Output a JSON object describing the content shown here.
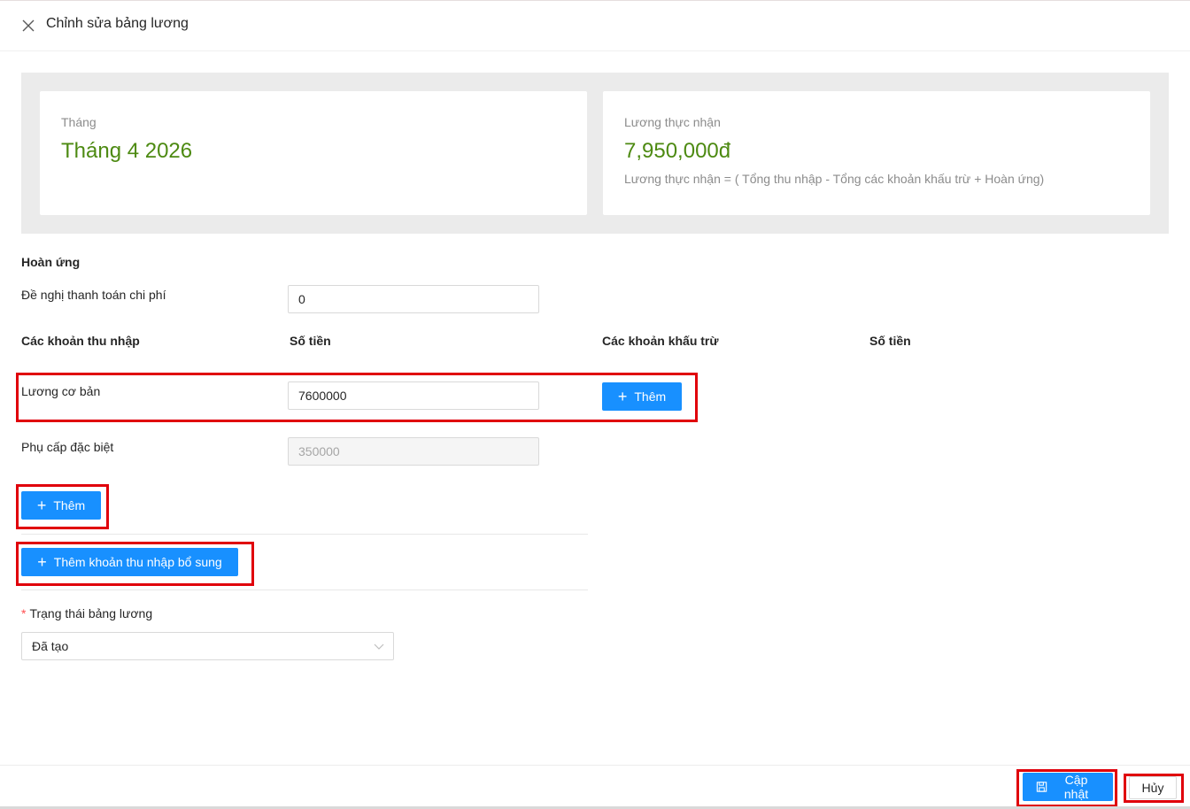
{
  "header": {
    "title": "Chỉnh sửa bảng lương"
  },
  "summary": {
    "month_label": "Tháng",
    "month_value": "Tháng 4 2026",
    "net_label": "Lương thực nhận",
    "net_value": "7,950,000đ",
    "net_formula": "Lương thực nhận = ( Tổng thu nhập - Tổng các khoản khấu trừ + Hoàn ứng)"
  },
  "reimbursement": {
    "title": "Hoàn ứng",
    "expense_label": "Đề nghị thanh toán chi phí",
    "expense_value": "0"
  },
  "columns": {
    "income": "Các khoản thu nhập",
    "income_amount": "Số tiền",
    "deduction": "Các khoản khấu trừ",
    "deduction_amount": "Số tiền"
  },
  "income_items": [
    {
      "label": "Lương cơ bản",
      "value": "7600000"
    },
    {
      "label": "Phụ cấp đặc biệt",
      "value": "350000"
    }
  ],
  "buttons": {
    "add": "Thêm",
    "add_deduction": "Thêm",
    "add_extra_income": "Thêm khoản thu nhập bổ sung",
    "update": "Cập nhật",
    "cancel": "Hủy"
  },
  "status": {
    "required_mark": "*",
    "label": "Trạng thái bảng lương",
    "value": "Đã tạo"
  },
  "colors": {
    "primary": "#1890ff",
    "accent_green": "#4d8a12",
    "highlight_red": "#e0000b"
  }
}
